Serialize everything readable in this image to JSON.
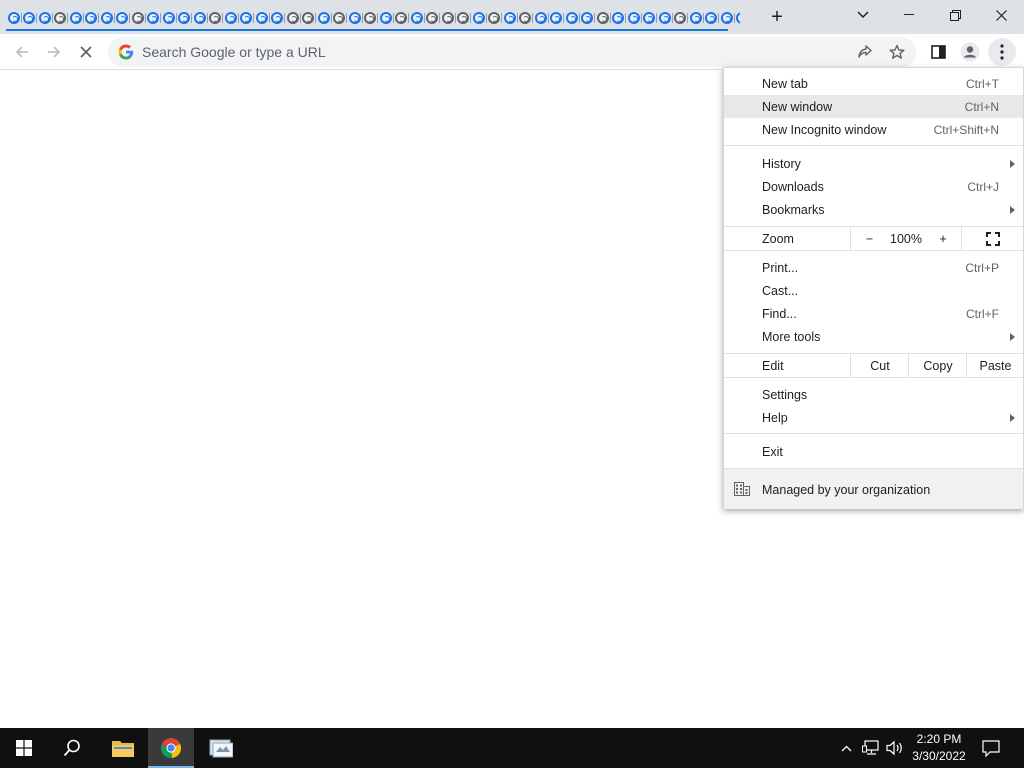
{
  "tabstrip": {
    "tab_count": 48,
    "new_tab_label": "+"
  },
  "toolbar": {
    "omnibox_placeholder": "Search Google or type a URL"
  },
  "menu": {
    "new_tab": {
      "label": "New tab",
      "shortcut": "Ctrl+T"
    },
    "new_window": {
      "label": "New window",
      "shortcut": "Ctrl+N"
    },
    "new_incognito": {
      "label": "New Incognito window",
      "shortcut": "Ctrl+Shift+N"
    },
    "history": {
      "label": "History"
    },
    "downloads": {
      "label": "Downloads",
      "shortcut": "Ctrl+J"
    },
    "bookmarks": {
      "label": "Bookmarks"
    },
    "zoom": {
      "label": "Zoom",
      "minus": "−",
      "value": "100%",
      "plus": "+"
    },
    "print": {
      "label": "Print...",
      "shortcut": "Ctrl+P"
    },
    "cast": {
      "label": "Cast..."
    },
    "find": {
      "label": "Find...",
      "shortcut": "Ctrl+F"
    },
    "more_tools": {
      "label": "More tools"
    },
    "edit": {
      "label": "Edit",
      "cut": "Cut",
      "copy": "Copy",
      "paste": "Paste"
    },
    "settings": {
      "label": "Settings"
    },
    "help": {
      "label": "Help"
    },
    "exit": {
      "label": "Exit"
    },
    "managed": {
      "label": "Managed by your organization"
    }
  },
  "taskbar": {
    "time": "2:20 PM",
    "date": "3/30/2022"
  },
  "colors": {
    "accent": "#1a73e8",
    "tabstrip_bg": "#dee1e6",
    "taskbar_bg": "#101010"
  }
}
